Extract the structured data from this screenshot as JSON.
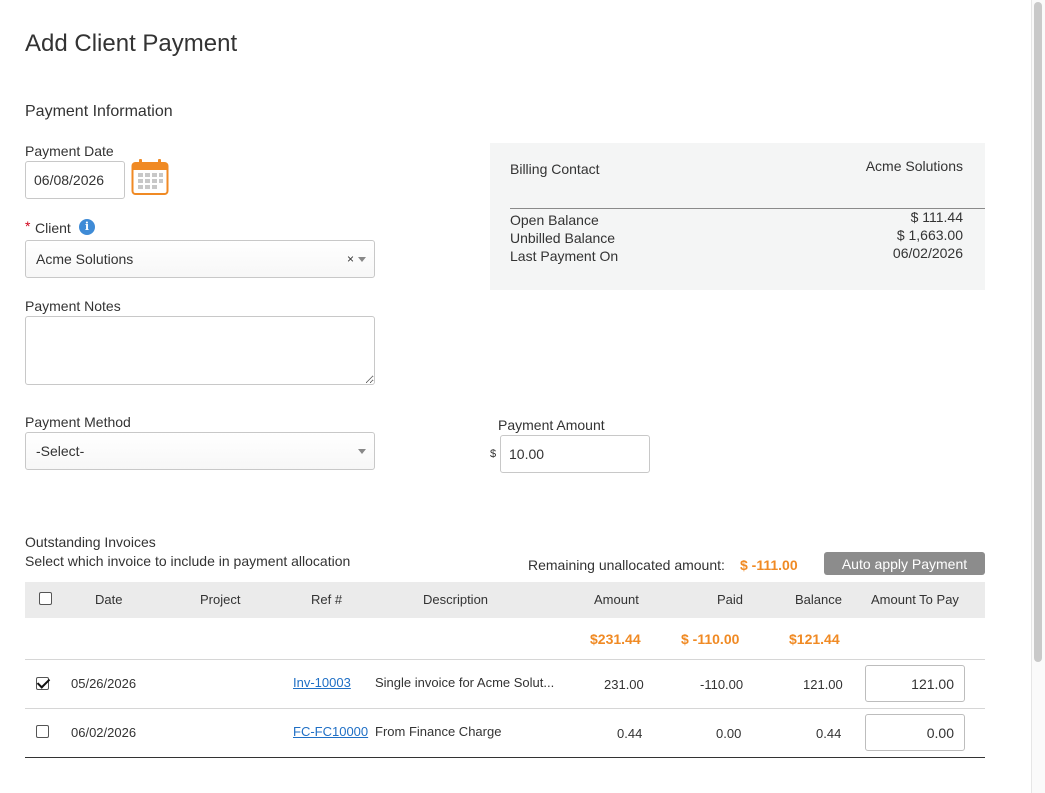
{
  "page": {
    "title": "Add Client Payment"
  },
  "payment_info": {
    "section_title": "Payment Information",
    "date_label": "Payment Date",
    "date_value": "06/08/2026",
    "client_required_mark": "*",
    "client_label": "Client",
    "client_value": "Acme Solutions",
    "client_clear": "×",
    "notes_label": "Payment Notes",
    "notes_value": "",
    "method_label": "Payment Method",
    "method_value": "-Select-",
    "amount_label": "Payment Amount",
    "currency_symbol": "$",
    "amount_value": "10.00"
  },
  "summary": {
    "billing_contact_label": "Billing Contact",
    "billing_contact_value": "Acme Solutions",
    "open_balance_label": "Open Balance",
    "open_balance_value": "$ 111.44",
    "unbilled_balance_label": "Unbilled Balance",
    "unbilled_balance_value": "$ 1,663.00",
    "last_payment_label": "Last Payment On",
    "last_payment_value": "06/02/2026"
  },
  "invoices": {
    "title": "Outstanding Invoices",
    "subtitle": "Select which invoice to include in payment allocation",
    "remaining_label": "Remaining unallocated amount:",
    "remaining_value": "$ -111.00",
    "auto_apply_label": "Auto apply Payment",
    "columns": [
      "Date",
      "Project",
      "Ref #",
      "Description",
      "Amount",
      "Paid",
      "Balance",
      "Amount To Pay"
    ],
    "totals": {
      "amount": "$231.44",
      "paid": "$ -110.00",
      "balance": "$121.44"
    },
    "rows": [
      {
        "checked": true,
        "date": "05/26/2026",
        "project": "",
        "ref": "Inv-10003",
        "description": "Single invoice for Acme Solut...",
        "amount": "231.00",
        "paid": "-110.00",
        "balance": "121.00",
        "to_pay": "121.00"
      },
      {
        "checked": false,
        "date": "06/02/2026",
        "project": "",
        "ref": "FC-FC10000",
        "description": "From Finance Charge",
        "amount": "0.44",
        "paid": "0.00",
        "balance": "0.44",
        "to_pay": "0.00"
      }
    ]
  },
  "colors": {
    "accent_orange": "#f08a24",
    "link_blue": "#1f6fc5",
    "info_blue": "#3f8bd6",
    "required_red": "#d0021b"
  }
}
